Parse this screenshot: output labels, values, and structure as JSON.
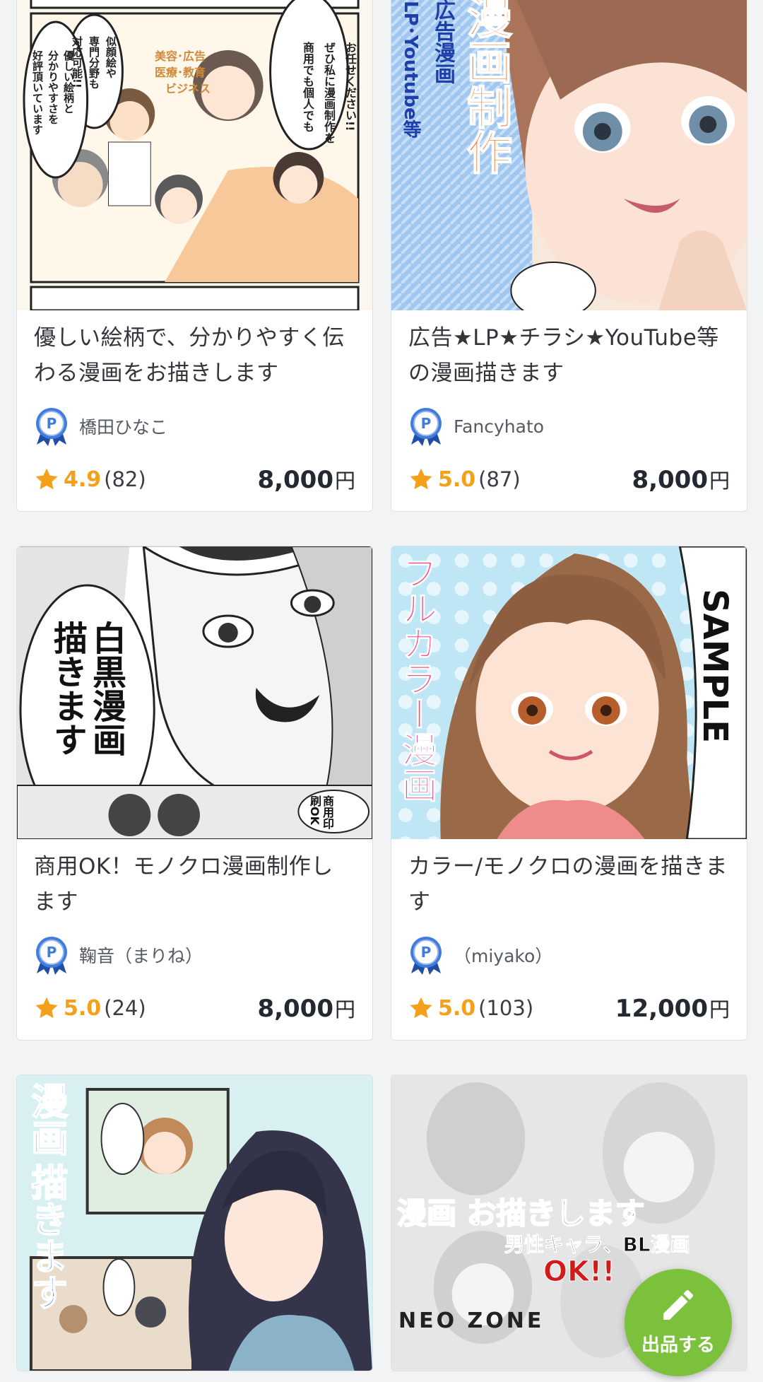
{
  "listings": [
    {
      "title": "優しい絵柄で、分かりやすく伝わる漫画をお描きします",
      "seller": "橋田ひなこ",
      "rating": "4.9",
      "reviews": "(82)",
      "price": "8,000",
      "currency": "円",
      "thumb_lines": [
        "商用でも個人でも",
        "ぜひ私に漫画制作を",
        "お任せください!!",
        "似顔絵や",
        "専門分野も",
        "対応可能!!",
        "優しい絵柄と",
        "分かりやすさを",
        "好評頂いています",
        "美容･広告",
        "医療･教育",
        "ビジネス"
      ]
    },
    {
      "title": "広告★LP★チラシ★YouTube等の漫画描きます",
      "seller": "Fancyhato",
      "rating": "5.0",
      "reviews": "(87)",
      "price": "8,000",
      "currency": "円",
      "thumb_lines": [
        "漫画制作",
        "広告漫画",
        "LP･Youtube等"
      ]
    },
    {
      "title": "商用OK！モノクロ漫画制作します",
      "seller": "鞠音（まりね）",
      "rating": "5.0",
      "reviews": "(24)",
      "price": "8,000",
      "currency": "円",
      "thumb_lines": [
        "白黒漫画",
        "描きます",
        "商用印刷OK"
      ]
    },
    {
      "title": "カラー/モノクロの漫画を描きます",
      "seller": "（miyako）",
      "rating": "5.0",
      "reviews": "(103)",
      "price": "12,000",
      "currency": "円",
      "thumb_lines": [
        "フルカラー漫画",
        "SAMPLE"
      ]
    },
    {
      "thumb_lines": [
        "漫画",
        "描きます"
      ]
    },
    {
      "thumb_lines": [
        "漫画 お描きします",
        "男性キャラ、BL漫画",
        "OK!!",
        "NEO ZONE"
      ]
    }
  ],
  "fab": {
    "label": "出品する",
    "icon": "pencil-icon"
  },
  "colors": {
    "star": "#f5a01a",
    "fab": "#7cc13c",
    "price": "#242830"
  }
}
